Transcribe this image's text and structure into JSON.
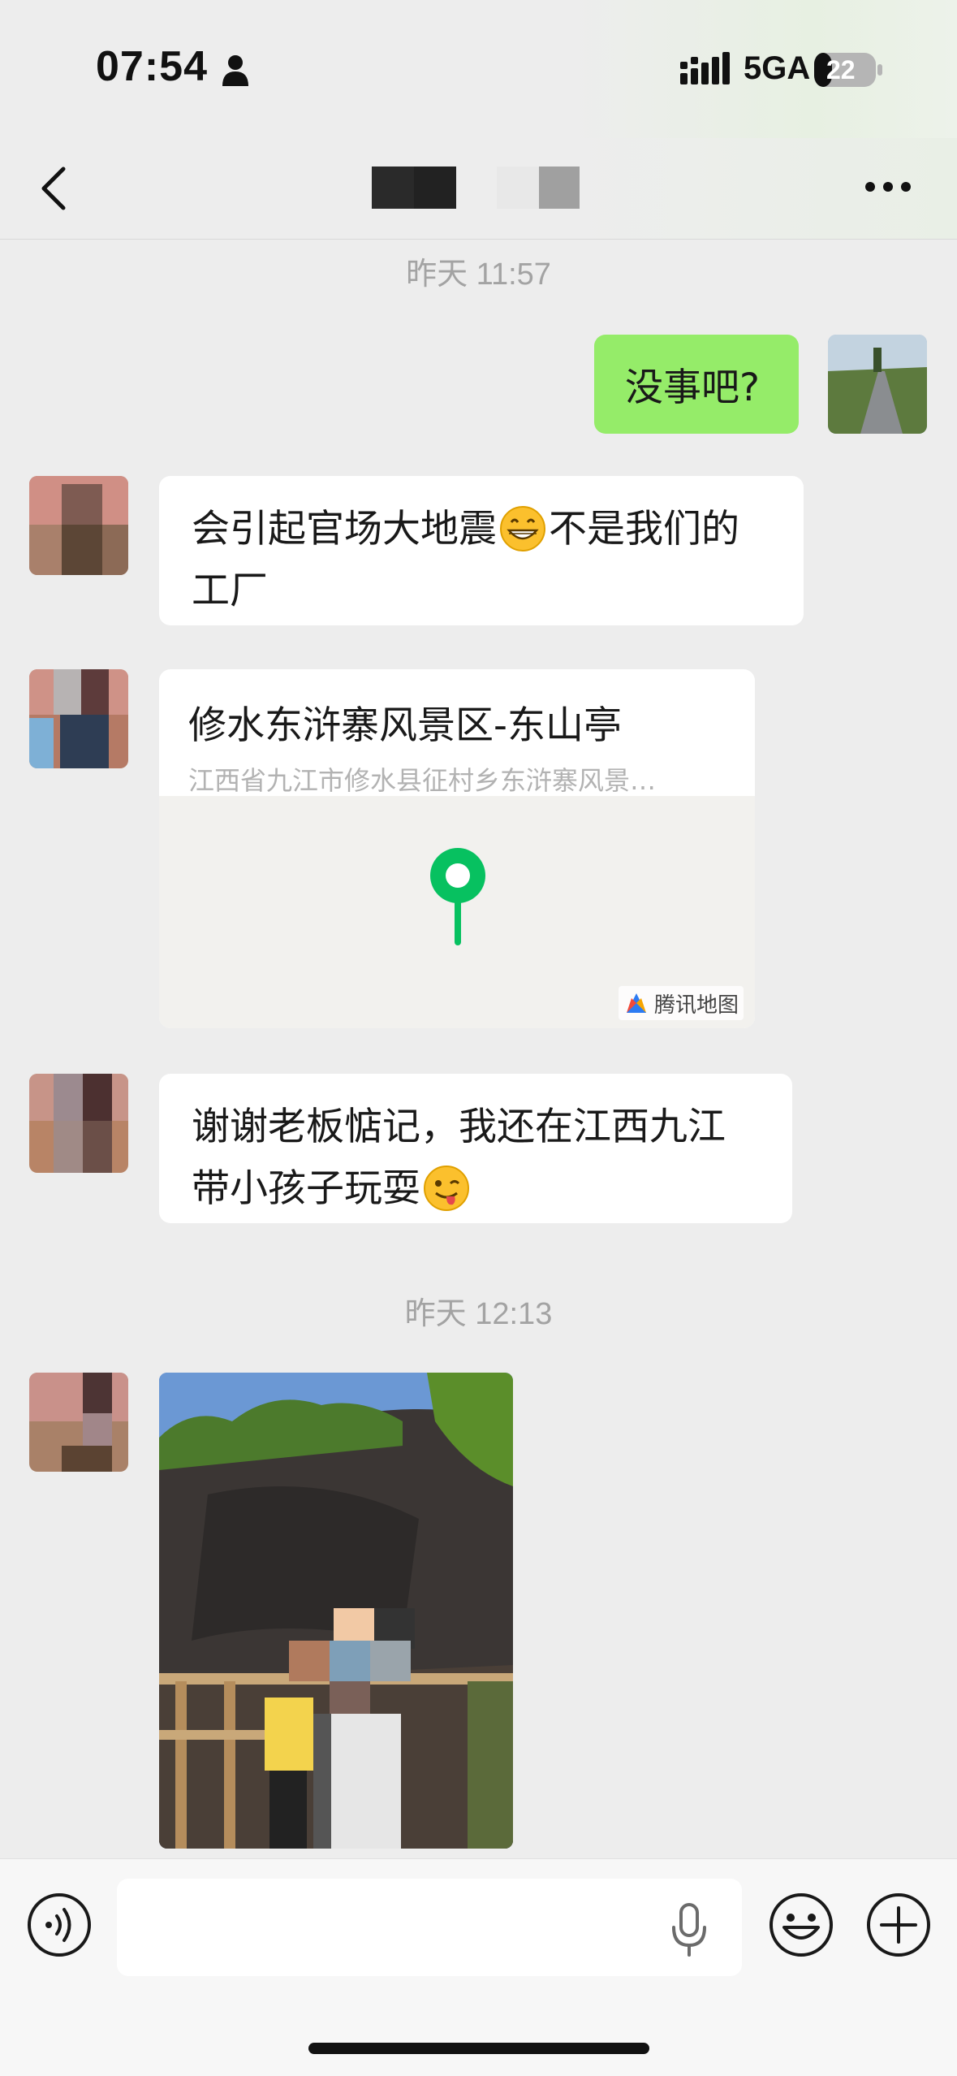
{
  "status_bar": {
    "time": "07:54",
    "network": "5GA",
    "battery": "22"
  },
  "nav": {
    "back_icon": "chevron-left-icon",
    "contact_name_blurred": true,
    "more_icon": "ellipsis-icon"
  },
  "messages": {
    "ts1": "昨天 11:57",
    "m1_text": "没事吧?",
    "m2_text_a": "会引起官场大地震",
    "m2_emoji": "grinning-face-icon",
    "m2_text_b": "不是我们的工厂",
    "location": {
      "name": "修水东浒寨风景区-东山亭",
      "address": "江西省九江市修水县征村乡东浒寨风景…",
      "provider": "腾讯地图"
    },
    "m4_text": "谢谢老板惦记，我还在江西九江带小孩子玩耍",
    "m4_emoji": "winking-tongue-face-icon",
    "ts2": "昨天 12:13"
  },
  "input": {
    "value": "",
    "placeholder": ""
  },
  "colors": {
    "background": "#ededed",
    "sent_bubble": "#95ec69",
    "received_bubble": "#ffffff",
    "map_pin": "#07c160"
  }
}
